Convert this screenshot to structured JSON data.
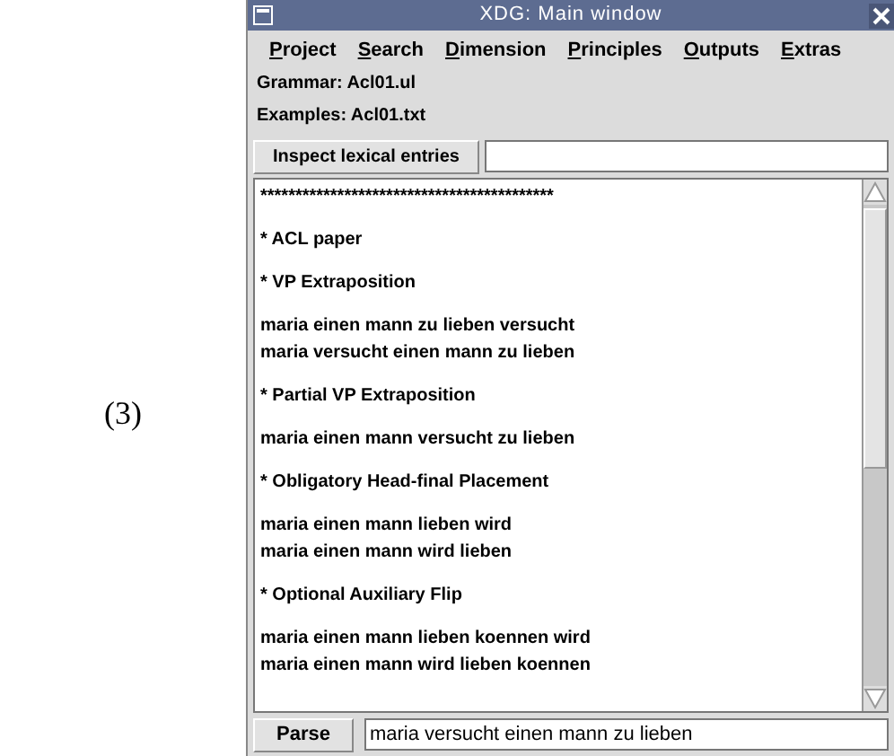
{
  "figure_label": "(3)",
  "window": {
    "title": "XDG: Main window"
  },
  "menu": [
    "Project",
    "Search",
    "Dimension",
    "Principles",
    "Outputs",
    "Extras"
  ],
  "info_lines": [
    "Grammar: Acl01.ul",
    "Examples: Acl01.txt"
  ],
  "inspect": {
    "button": "Inspect lexical entries"
  },
  "text_area": {
    "blocks": [
      [
        "******************************************"
      ],
      [
        "* ACL paper"
      ],
      [
        "* VP Extraposition"
      ],
      [
        "maria einen mann zu lieben versucht",
        "maria versucht einen mann zu lieben"
      ],
      [
        "* Partial VP Extraposition"
      ],
      [
        "maria einen mann versucht zu lieben"
      ],
      [
        "* Obligatory Head-final Placement"
      ],
      [
        "maria einen mann lieben wird",
        "maria einen mann wird lieben"
      ],
      [
        "* Optional Auxiliary Flip"
      ],
      [
        "maria einen mann lieben koennen wird",
        "maria einen mann wird lieben koennen"
      ]
    ]
  },
  "parse": {
    "button": "Parse",
    "value": "maria versucht einen mann zu lieben"
  }
}
